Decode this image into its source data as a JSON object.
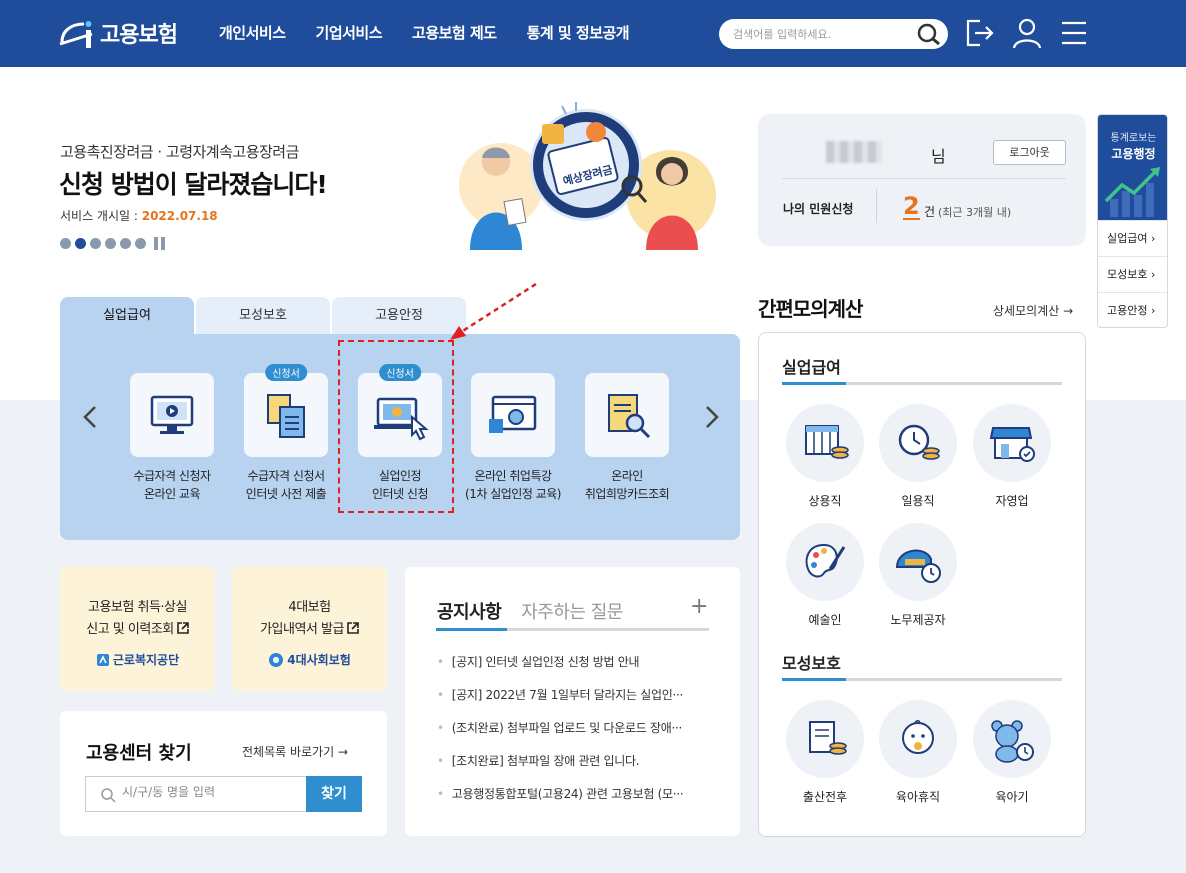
{
  "header": {
    "logo_text": "고용보험",
    "nav": [
      "개인서비스",
      "기업서비스",
      "고용보험 제도",
      "통계 및 정보공개"
    ],
    "search_placeholder": "검색어를 입력하세요."
  },
  "banner": {
    "subtitle": "고용촉진장려금 · 고령자계속고용장려금",
    "title": "신청 방법이 달라졌습니다!",
    "date_label": "서비스 개시일 : ",
    "date_value": "2022.07.18",
    "illustration_text": "예상장려금"
  },
  "tabs": [
    "실업급여",
    "모성보호",
    "고용안정"
  ],
  "services": [
    {
      "label": "수급자격 신청자\n온라인 교육",
      "badge": ""
    },
    {
      "label": "수급자격 신청서\n인터넷 사전 제출",
      "badge": "신청서"
    },
    {
      "label": "실업인정\n인터넷 신청",
      "badge": "신청서"
    },
    {
      "label": "온라인 취업특강\n(1차 실업인정 교육)",
      "badge": ""
    },
    {
      "label": "온라인\n취업희망카드조회",
      "badge": ""
    }
  ],
  "quick_links": [
    {
      "label": "고용보험 취득·상실\n신고 및 이력조회",
      "org": "근로복지공단"
    },
    {
      "label": "4대보험\n가입내역서 발급",
      "org": "4대사회보험"
    }
  ],
  "center": {
    "title": "고용센터 찾기",
    "link": "전체목록 바로가기",
    "placeholder": "시/구/동 명을 입력",
    "button": "찾기"
  },
  "notice": {
    "tabs": [
      "공지사항",
      "자주하는 질문"
    ],
    "plus": "+",
    "items": [
      "[공지] 인터넷 실업인정 신청 방법 안내",
      "[공지] 2022년 7월 1일부터 달라지는 실업인···",
      "(조치완료) 첨부파일 업로드 및 다운로드 장애···",
      "[조치완료] 첨부파일 장애 관련 입니다.",
      "고용행정통합포털(고용24) 관련 고용보험 (모···"
    ]
  },
  "user": {
    "suffix": "님",
    "logout": "로그아웃",
    "my_apply": "나의 민원신청",
    "count": "2",
    "unit": "건",
    "note": "(최근 3개월 내)"
  },
  "calc": {
    "title": "간편모의계산",
    "link": "상세모의계산",
    "sections": [
      {
        "title": "실업급여",
        "items": [
          "상용직",
          "일용직",
          "자영업",
          "예술인",
          "노무제공자"
        ]
      },
      {
        "title": "모성보호",
        "items": [
          "출산전후",
          "육아휴직",
          "육아기"
        ]
      }
    ]
  },
  "side": {
    "line1": "통계로보는",
    "line2": "고용행정",
    "items": [
      "실업급여",
      "모성보호",
      "고용안정"
    ]
  },
  "colors": {
    "brand": "#1f4d9c",
    "accent": "#2f8ed0",
    "highlight": "#e8731d",
    "annotation": "#e02020"
  }
}
